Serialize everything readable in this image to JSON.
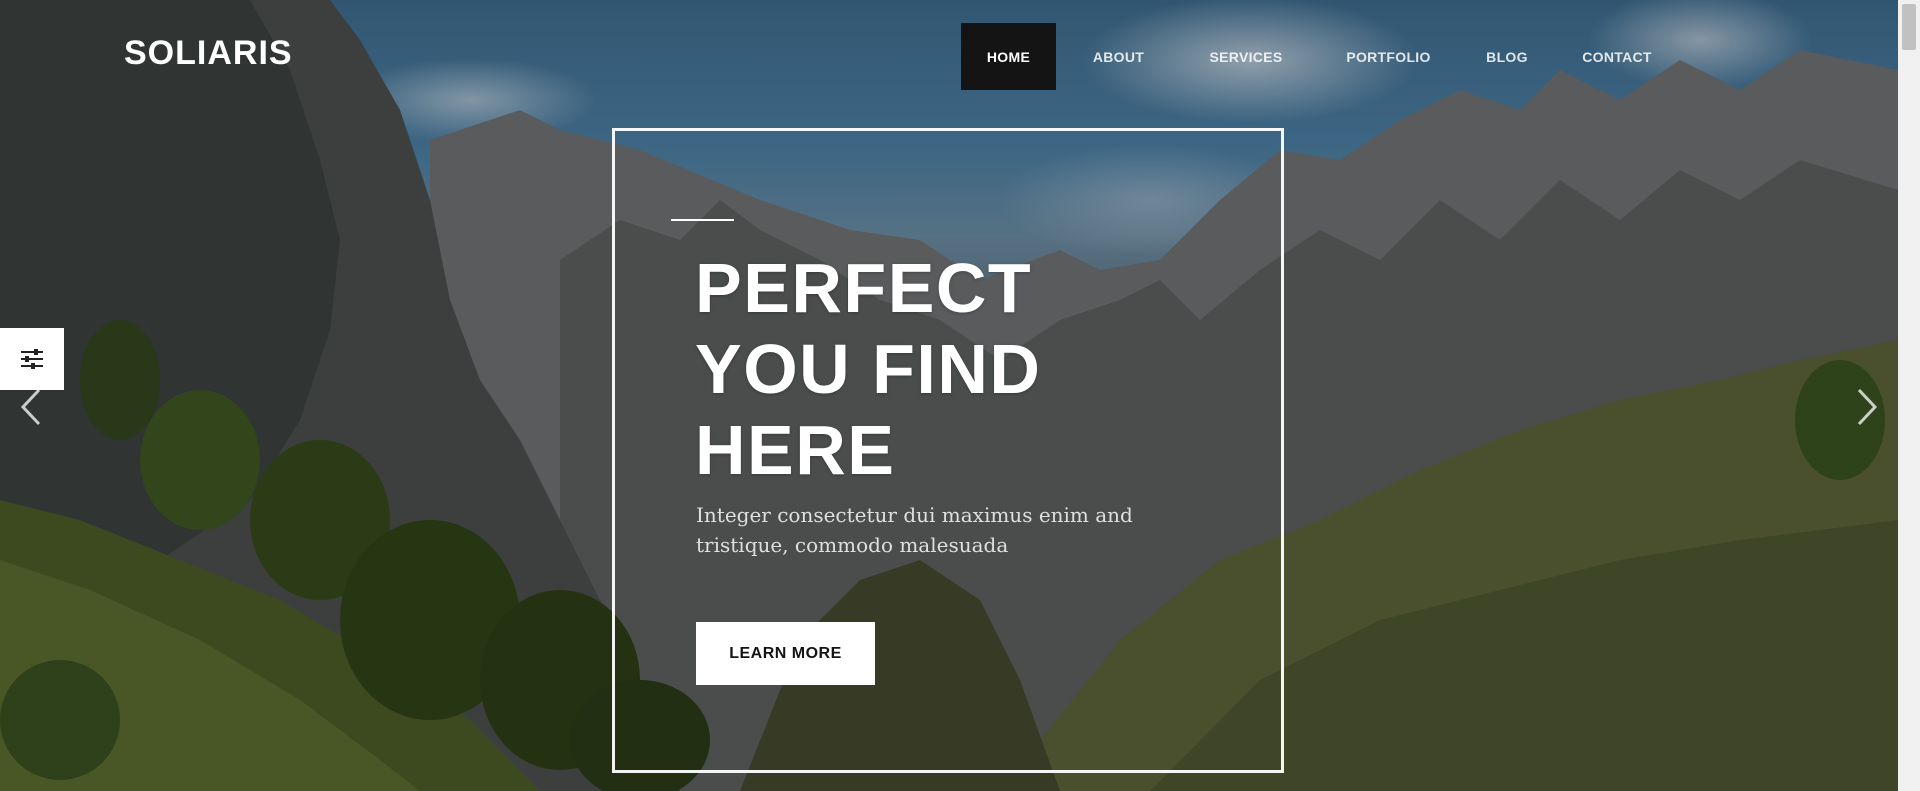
{
  "brand": {
    "logo_text": "SOLIARIS"
  },
  "nav": {
    "items": [
      {
        "label": "HOME",
        "active": true
      },
      {
        "label": "ABOUT"
      },
      {
        "label": "SERVICES"
      },
      {
        "label": "PORTFOLIO"
      },
      {
        "label": "BLOG"
      },
      {
        "label": "CONTACT"
      }
    ]
  },
  "hero": {
    "headline_lines": [
      "PERFECT",
      "YOU FIND",
      "HERE"
    ],
    "subtext": "Integer consectetur dui maximus enim and tristique, commodo malesuada",
    "cta_label": "LEARN MORE"
  },
  "icons": {
    "settings": "sliders-icon",
    "prev": "chevron-left-icon",
    "next": "chevron-right-icon"
  },
  "colors": {
    "nav_active_bg": "#141414",
    "text_light": "#ffffff",
    "cta_bg": "#ffffff",
    "cta_text": "#141414"
  }
}
